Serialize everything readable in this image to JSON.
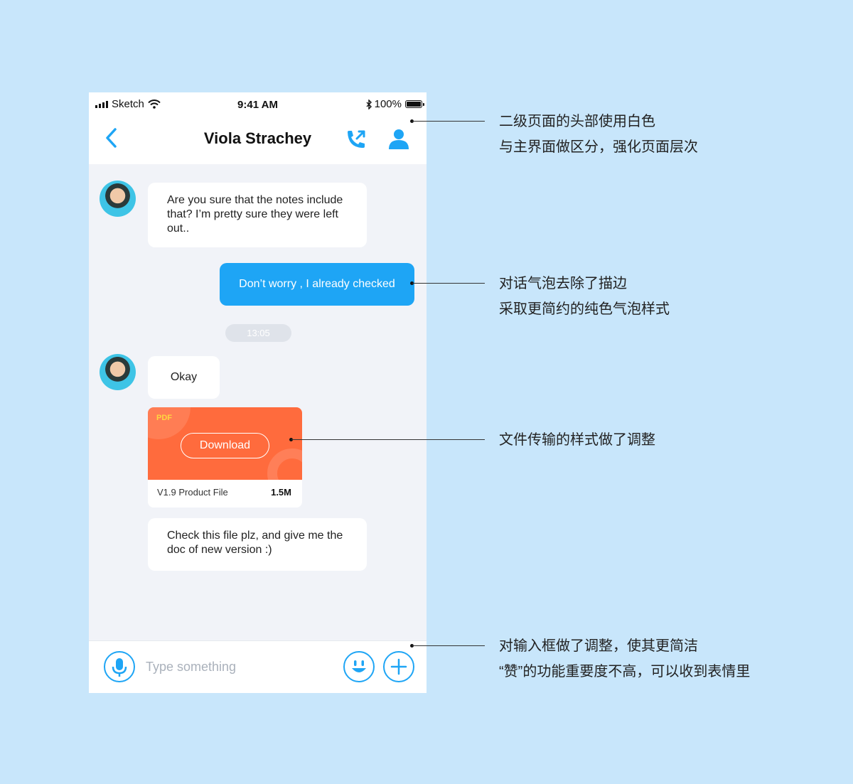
{
  "status_bar": {
    "carrier": "Sketch",
    "time": "9:41 AM",
    "battery": "100%"
  },
  "header": {
    "title": "Viola Strachey"
  },
  "messages": {
    "m1": "Are you sure that the notes include that? I’m pretty sure they were left out..",
    "m2": "Don’t worry , I already checked",
    "timestamp": "13:05",
    "m3": "Okay",
    "file": {
      "type": "PDF",
      "button": "Download",
      "name": "V1.9 Product File",
      "size": "1.5M"
    },
    "m4": "Check this file plz, and give me the doc of new version :)"
  },
  "input": {
    "placeholder": "Type something"
  },
  "annotations": {
    "a1": [
      "二级页面的头部使用白色",
      "与主界面做区分，强化页面层次"
    ],
    "a2": [
      "对话气泡去除了描边",
      "采取更简约的纯色气泡样式"
    ],
    "a3": [
      "文件传输的样式做了调整"
    ],
    "a4": [
      "对输入框做了调整，使其更简洁",
      "“赞”的功能重要度不高，可以收到表情里"
    ]
  },
  "colors": {
    "background": "#c8e6fb",
    "accent": "#1ea5f5",
    "file_card": "#ff6b3d",
    "chat_bg": "#f1f3f8"
  },
  "icons": [
    "signal-icon",
    "wifi-icon",
    "bluetooth-icon",
    "battery-icon",
    "back-arrow-icon",
    "call-icon",
    "profile-icon",
    "microphone-icon",
    "emoji-icon",
    "plus-icon"
  ]
}
